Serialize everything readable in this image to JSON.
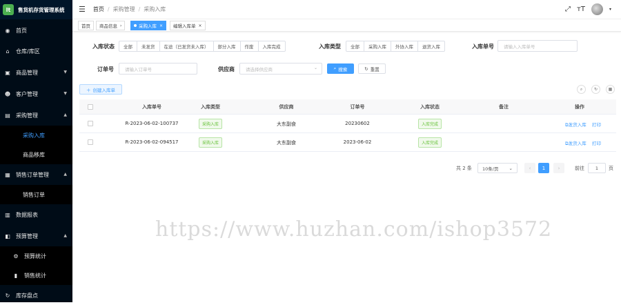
{
  "app": {
    "logo_mark": "lt",
    "title": "售货机存货管理系统"
  },
  "sidebar": {
    "items": [
      {
        "label": "首页",
        "icon": "dashboard-icon"
      },
      {
        "label": "仓库/库区",
        "icon": "warehouse-icon"
      },
      {
        "label": "商品管理",
        "icon": "cart-icon"
      },
      {
        "label": "客户管理",
        "icon": "users-icon"
      },
      {
        "label": "采购管理",
        "icon": "purchase-icon"
      },
      {
        "label": "采购入库",
        "icon": ""
      },
      {
        "label": "商品移库",
        "icon": ""
      },
      {
        "label": "销售订单管理",
        "icon": "sales-icon"
      },
      {
        "label": "销售订单",
        "icon": ""
      },
      {
        "label": "数据报表",
        "icon": "chart-icon"
      },
      {
        "label": "预算管理",
        "icon": "budget-icon"
      },
      {
        "label": "预算统计",
        "icon": "stats-icon"
      },
      {
        "label": "销售统计",
        "icon": "book-icon"
      },
      {
        "label": "库存盘点",
        "icon": "inventory-icon"
      }
    ]
  },
  "header": {
    "breadcrumb": [
      "首页",
      "采购管理",
      "采购入库"
    ],
    "tags": [
      "首页",
      "商品信息",
      "采购入库",
      "编辑入库单"
    ]
  },
  "filters": {
    "status_label": "入库状态",
    "status_options": [
      "全部",
      "未发货",
      "在途（已发货未入库）",
      "部分入库",
      "作废",
      "入库完成"
    ],
    "type_label": "入库类型",
    "type_options": [
      "全部",
      "采购入库",
      "外协入库",
      "退货入库"
    ],
    "no_label": "入库单号",
    "no_placeholder": "请输入入库单号",
    "order_label": "订单号",
    "order_placeholder": "请输入订单号",
    "supplier_label": "供应商",
    "supplier_placeholder": "请选择供应商",
    "search_btn": "搜索",
    "reset_btn": "重置"
  },
  "toolbar": {
    "create_btn": "创建入库单"
  },
  "table": {
    "headers": [
      "入库单号",
      "入库类型",
      "供应商",
      "订单号",
      "入库状态",
      "备注",
      "操作"
    ],
    "rows": [
      {
        "no": "R-2023-06-02-100737",
        "type": "采购入库",
        "supplier": "大东副食",
        "order": "20230602",
        "status": "入库完成",
        "remark": "",
        "action1": "发货入库",
        "action2": "打印"
      },
      {
        "no": "R-2023-06-02-094517",
        "type": "采购入库",
        "supplier": "大东副食",
        "order": "2023-06-02",
        "status": "入库完成",
        "remark": "",
        "action1": "发货入库",
        "action2": "打印"
      }
    ]
  },
  "pager": {
    "total": "共 2 条",
    "size": "10条/页",
    "page": "1",
    "goto": "前往",
    "goto_val": "1",
    "unit": "页"
  },
  "watermark": "https://www.huzhan.com/ishop3572"
}
